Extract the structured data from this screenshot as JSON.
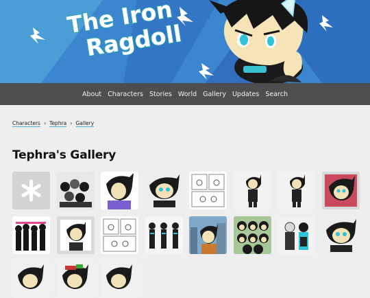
{
  "site": {
    "title_line1": "The Iron",
    "title_line2": "Ragdoll"
  },
  "nav": {
    "items": [
      "About",
      "Characters",
      "Stories",
      "World",
      "Gallery",
      "Updates",
      "Search"
    ]
  },
  "breadcrumb": {
    "items": [
      "Characters",
      "Tephra",
      "Gallery"
    ],
    "separator": "›"
  },
  "page": {
    "title": "Tephra's Gallery"
  },
  "colors": {
    "banner_blue": "#3c86d0",
    "nav_bg": "#4e4e4e",
    "page_bg": "#eeeeee",
    "accent_teal": "#2fa6b4",
    "thumb_bg": "#d6d6d6"
  },
  "gallery": {
    "thumbnails": [
      {
        "name": "thumb-snowflake-icon",
        "kind": "snowflake"
      },
      {
        "name": "thumb-group-sketch",
        "kind": "group"
      },
      {
        "name": "thumb-portrait-purple",
        "kind": "portrait"
      },
      {
        "name": "thumb-face-closeup",
        "kind": "face"
      },
      {
        "name": "thumb-comic-page",
        "kind": "comic"
      },
      {
        "name": "thumb-standing-figure",
        "kind": "figure"
      },
      {
        "name": "thumb-gun-pose",
        "kind": "figure"
      },
      {
        "name": "thumb-red-portrait",
        "kind": "red"
      },
      {
        "name": "thumb-silhouettes",
        "kind": "silhouettes"
      },
      {
        "name": "thumb-framed-bust",
        "kind": "bust"
      },
      {
        "name": "thumb-comic-sketch",
        "kind": "comic"
      },
      {
        "name": "thumb-character-turnaround",
        "kind": "turnaround"
      },
      {
        "name": "thumb-city-scene",
        "kind": "city"
      },
      {
        "name": "thumb-expression-sheet",
        "kind": "expressions"
      },
      {
        "name": "thumb-duo-figures",
        "kind": "duo"
      },
      {
        "name": "thumb-face-glasses",
        "kind": "face"
      },
      {
        "name": "thumb-partial-1",
        "kind": "partial"
      },
      {
        "name": "thumb-partial-2",
        "kind": "partial"
      },
      {
        "name": "thumb-partial-3",
        "kind": "partial"
      }
    ]
  }
}
